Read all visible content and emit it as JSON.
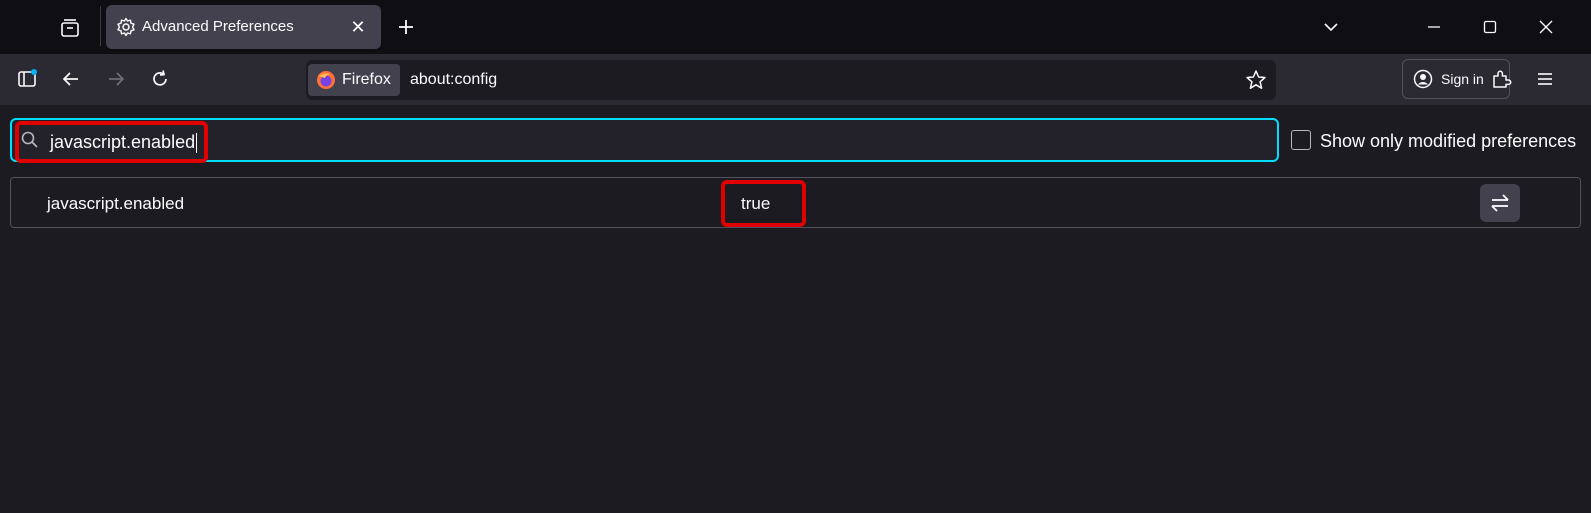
{
  "tab": {
    "title": "Advanced Preferences",
    "close_label": "✕"
  },
  "urlbar": {
    "identity_label": "Firefox",
    "url": "about:config"
  },
  "account": {
    "signin_label": "Sign in"
  },
  "config": {
    "search_value": "javascript.enabled",
    "modified_only_label": "Show only modified preferences",
    "modified_only_checked": false,
    "preferences": [
      {
        "name": "javascript.enabled",
        "value": "true",
        "type": "boolean"
      }
    ]
  },
  "colors": {
    "accent": "#00ddff",
    "highlight": "#e00000",
    "background": "#1c1b22",
    "toolbar": "#2b2a33",
    "tabstrip": "#0f0e13"
  },
  "icons": [
    "tab-list-icon",
    "gear-icon",
    "close-icon",
    "plus-icon",
    "chevron-down-icon",
    "minimize-icon",
    "maximize-icon",
    "window-close-icon",
    "sidebar-icon",
    "back-arrow-icon",
    "forward-arrow-icon",
    "reload-icon",
    "firefox-logo-icon",
    "star-icon",
    "account-icon",
    "extensions-icon",
    "hamburger-menu-icon",
    "search-icon",
    "toggle-icon"
  ]
}
